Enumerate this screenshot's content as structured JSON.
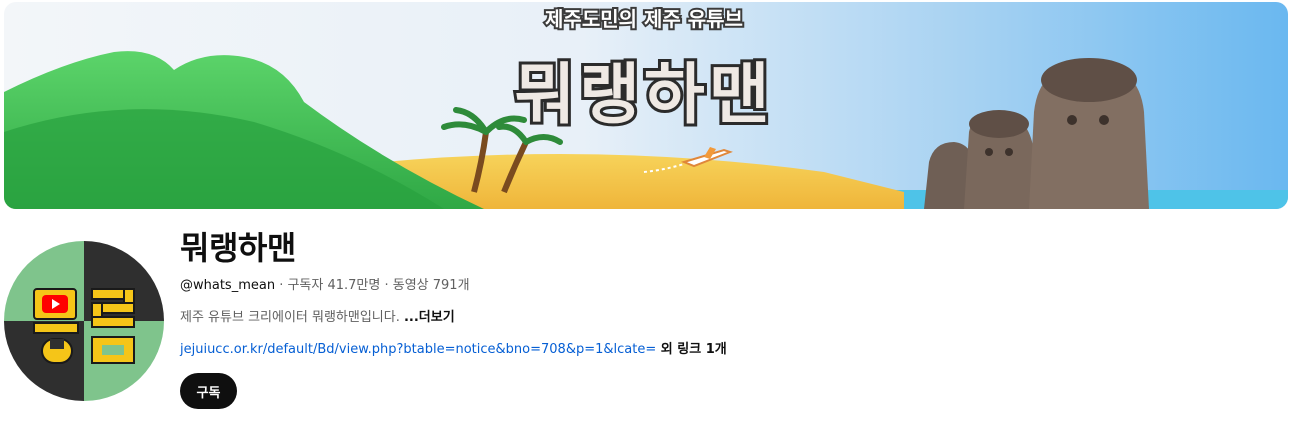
{
  "banner": {
    "subtitle": "제주도민의 제주 유튜브",
    "logo_text": "뭐랭하맨"
  },
  "avatar": {
    "text_top": "뭐랑",
    "letters": [
      "뭐",
      "랑"
    ]
  },
  "channel": {
    "title": "뭐랭하맨",
    "handle": "@whats_mean",
    "stats": " · 구독자 41.7만명 · 동영상 791개",
    "description": "제주 유튜브 크리에이터 뭐랭하맨입니다. ",
    "more_label": "...더보기",
    "link_text": "jejuiucc.or.kr/default/Bd/view.php?btable=notice&bno=708&p=1&lcate=",
    "more_links_label": " 외 링크 1개",
    "subscribe_label": "구독"
  }
}
